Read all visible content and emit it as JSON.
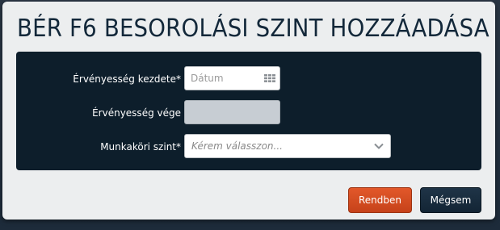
{
  "modal": {
    "title": "BÉR F6 BESOROLÁSI SZINT HOZZÁADÁSA"
  },
  "form": {
    "valid_from": {
      "label": "Érvényesség kezdete*",
      "placeholder": "Dátum",
      "value": ""
    },
    "valid_to": {
      "label": "Érvényesség vége",
      "value": "",
      "disabled": true
    },
    "job_level": {
      "label": "Munkaköri szint*",
      "selected": "Kérem válasszon..."
    }
  },
  "buttons": {
    "ok_label": "Rendben",
    "cancel_label": "Mégsem"
  },
  "icons": {
    "date_picker": "calendar-grid-icon",
    "dropdown": "chevron-down-icon"
  },
  "colors": {
    "title_text": "#13283a",
    "form_panel_bg": "#0d1e2b",
    "ok_button": "#d24e22",
    "cancel_button": "#182c3e",
    "disabled_field": "#c7cdd3"
  }
}
